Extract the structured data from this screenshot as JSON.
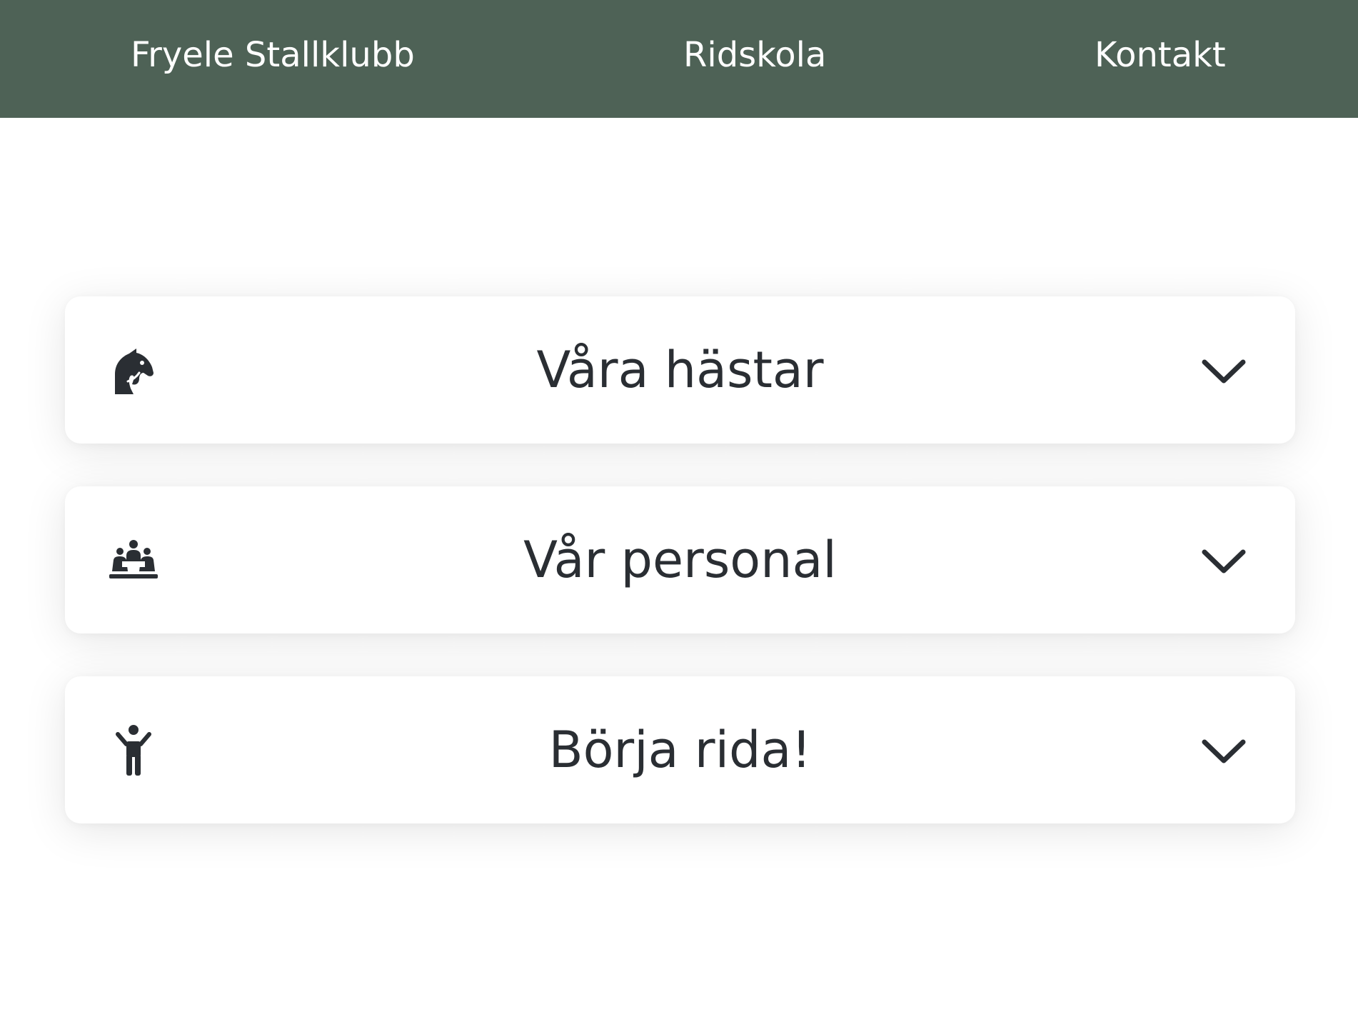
{
  "nav": {
    "brand": "Fryele Stallklubb",
    "links": [
      "Ridskola",
      "Kontakt"
    ]
  },
  "accordion": {
    "items": [
      {
        "title": "Våra hästar",
        "icon": "horse-head-icon"
      },
      {
        "title": "Vår personal",
        "icon": "people-group-icon"
      },
      {
        "title": "Börja rida!",
        "icon": "child-person-icon"
      }
    ],
    "toggle_icon": "chevron-down-icon"
  },
  "colors": {
    "navbar_bg": "#4e6256",
    "nav_text": "#ffffff",
    "card_text": "#2a2e33",
    "page_bg": "#ffffff"
  }
}
